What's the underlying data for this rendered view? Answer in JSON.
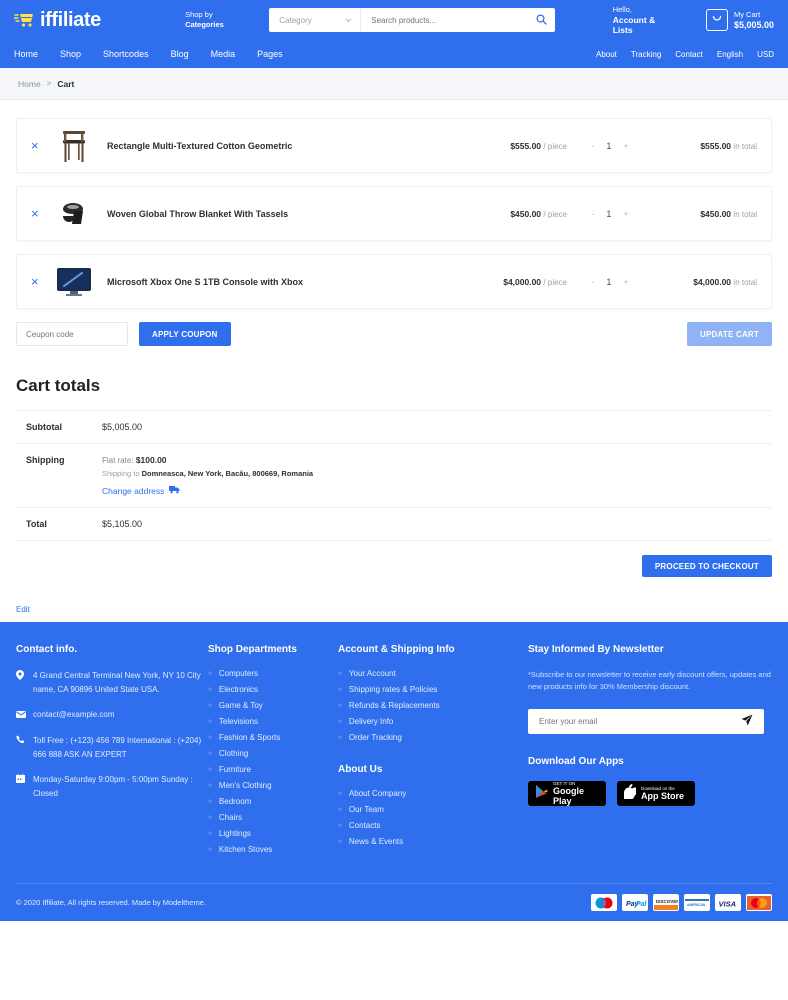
{
  "header": {
    "logo_text": "iffiliate",
    "logo_icon": "shopping-cart-icon",
    "shop_by_line1": "Shop by",
    "shop_by_line2": "Categories",
    "search": {
      "category_label": "Category",
      "placeholder": "Search products...",
      "value": "",
      "icon": "search-icon"
    },
    "account": {
      "hello": "Hello,",
      "label": "Account & Lists"
    },
    "cart": {
      "icon": "cart-icon",
      "label": "My Cart",
      "amount": "$5,005.00"
    },
    "mainnav": [
      "Home",
      "Shop",
      "Shortcodes",
      "Blog",
      "Media",
      "Pages"
    ],
    "subnav": [
      "About",
      "Tracking",
      "Contact",
      "English",
      "USD"
    ]
  },
  "breadcrumb": {
    "home": "Home",
    "separator": ">",
    "current": "Cart"
  },
  "cart_items": [
    {
      "remove": "×",
      "thumb": "wooden-chair-image",
      "name": "Rectangle Multi-Textured Cotton Geometric",
      "price": "$555.00",
      "price_unit": "/ piece",
      "qty": "1",
      "total": "$555.00",
      "total_label": "in total"
    },
    {
      "remove": "×",
      "thumb": "throw-blanket-image",
      "name": "Woven Global Throw Blanket With Tassels",
      "price": "$450.00",
      "price_unit": "/ piece",
      "qty": "1",
      "total": "$450.00",
      "total_label": "in total"
    },
    {
      "remove": "×",
      "thumb": "xbox-console-image",
      "name": "Microsoft Xbox One S 1TB Console with Xbox",
      "price": "$4,000.00",
      "price_unit": "/ piece",
      "qty": "1",
      "total": "$4,000.00",
      "total_label": "in total"
    }
  ],
  "qty_controls": {
    "minus": "-",
    "plus": "+"
  },
  "coupon": {
    "placeholder": "Ceupon code",
    "value": "",
    "apply_label": "APPLY COUPON",
    "update_label": "UPDATE CART"
  },
  "totals": {
    "title": "Cart totals",
    "subtotal_label": "Subtotal",
    "subtotal_value": "$5,005.00",
    "shipping_label": "Shipping",
    "flat_rate_prefix": "Flat rate:",
    "flat_rate_value": "$100.00",
    "shipping_to_prefix": "Shipping to",
    "shipping_to_address": "Domneasca, New York, Bacău, 800669, Romania",
    "change_address": "Change address",
    "change_address_icon": "truck-icon",
    "total_label": "Total",
    "total_value": "$5,105.00",
    "checkout_label": "PROCEED TO CHECKOUT"
  },
  "edit_link": "Edit",
  "footer": {
    "contact": {
      "heading": "Contact info.",
      "address_icon": "location-pin-icon",
      "address": "4 Grand Central Terminal New York, NY 10 City name, CA 90896 United State USA.",
      "email_icon": "envelope-icon",
      "email": "contact@example.com",
      "phone_icon": "phone-icon",
      "phone": "Toll Free : (+123) 456 789 International : (+204) 666 888 ASK AN EXPERT",
      "hours_icon": "calendar-icon",
      "hours": "Monday-Saturday 9:00pm - 5:00pm Sunday : Closed"
    },
    "departments": {
      "heading": "Shop Departments",
      "items": [
        "Computers",
        "Electronics",
        "Game & Toy",
        "Televisions",
        "Fashion & Sports",
        "Clothing",
        "Furniture",
        "Men's Clothing",
        "Bedroom",
        "Chairs",
        "Lightings",
        "Kitchen Stoves"
      ]
    },
    "account_info": {
      "heading": "Account & Shipping Info",
      "items": [
        "Your Account",
        "Shipping rates & Policies",
        "Refunds & Replacements",
        "Delivery Info",
        "Order Tracking"
      ]
    },
    "about": {
      "heading": "About Us",
      "items": [
        "About Company",
        "Our Team",
        "Contacts",
        "News & Events"
      ]
    },
    "newsletter": {
      "heading": "Stay Informed By Newsletter",
      "description": "*Subscribe to our newsletter to receive early discount offers, updates and new products info for 30% Membership discount.",
      "placeholder": "Enter your email",
      "value": "",
      "send_icon": "paper-plane-icon"
    },
    "apps": {
      "heading": "Download Our Apps",
      "google": {
        "icon": "google-play-icon",
        "line1": "GET IT ON",
        "line2": "Google Play"
      },
      "apple": {
        "icon": "apple-icon",
        "line1": "Download on the",
        "line2": "App Store"
      }
    },
    "copyright": "© 2020 Iffiliate, All rights reserved. Made by Modeltheme.",
    "payments": [
      "Maestro",
      "PayPal",
      "Discover",
      "Amex",
      "VISA",
      "Mastercard"
    ]
  },
  "colors": {
    "brand_blue": "#2f6fed",
    "accent_yellow": "#ffe14d",
    "muted_blue": "#8fb3f5"
  }
}
